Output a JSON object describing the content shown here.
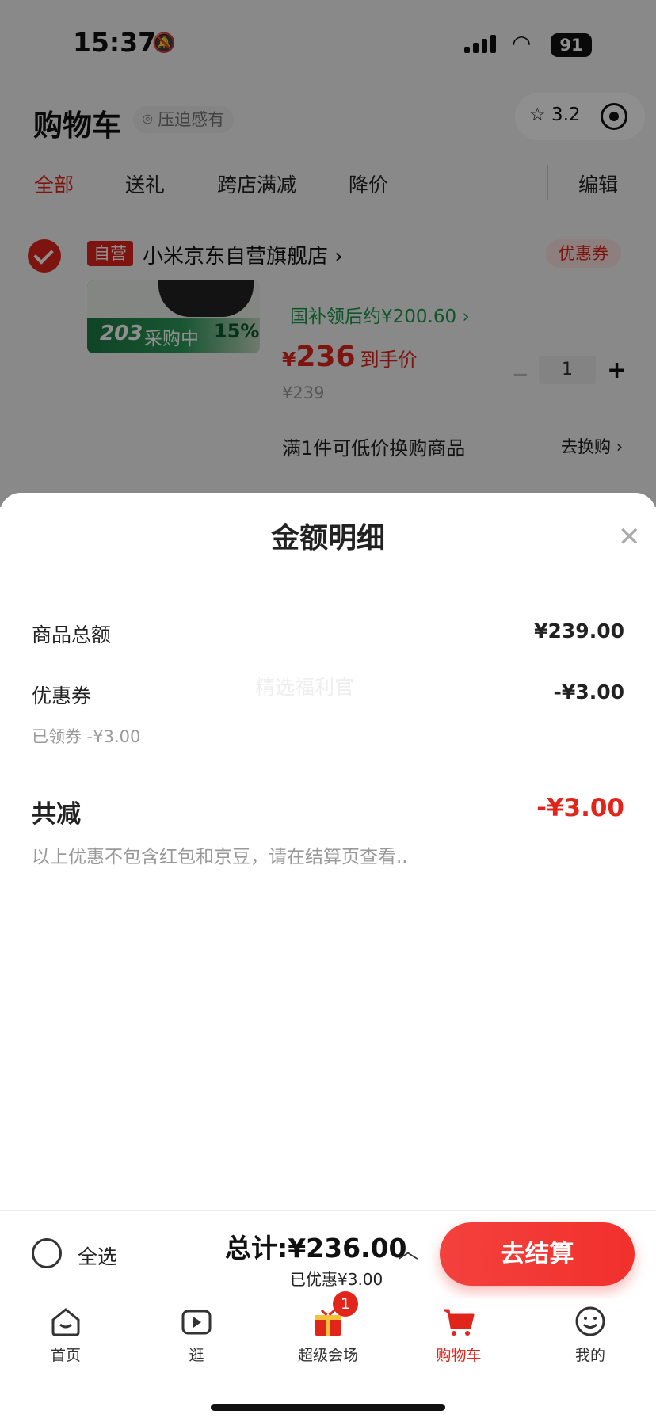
{
  "status_bar": {
    "time": "15:37",
    "battery": "91"
  },
  "header": {
    "title": "购物车",
    "location": "压迫感有",
    "capsule_score": "3.2"
  },
  "tabs": [
    "全部",
    "送礼",
    "跨店满减",
    "降价"
  ],
  "edit_label": "编辑",
  "shop": {
    "badge": "自营",
    "name": "小米京东自营旗舰店",
    "coupon": "优惠券"
  },
  "product": {
    "image_text": {
      "count": "203",
      "status": "采购中",
      "percent": "15%"
    },
    "subsidy": "国补领后约¥200.60",
    "price_symbol": "¥",
    "price": "236",
    "price_label": "到手价",
    "original_price": "¥239",
    "quantity": "1",
    "swap_text": "满1件可低价换购商品",
    "swap_action": "去换购"
  },
  "sheet": {
    "title": "金额明细",
    "rows": [
      {
        "label": "商品总额",
        "value": "¥239.00"
      },
      {
        "label": "优惠券",
        "value": "-¥3.00",
        "sub": "已领券 -¥3.00"
      }
    ],
    "watermark": "精选福利官",
    "total_label": "共减",
    "total_value": "-¥3.00",
    "note": "以上优惠不包含红包和京豆，请在结算页查看.."
  },
  "bottom_bar": {
    "select_all": "全选",
    "total": "总计:¥236.00",
    "saved": "已优惠¥3.00",
    "checkout": "去结算"
  },
  "nav": {
    "items": [
      {
        "label": "首页",
        "icon": "home-icon"
      },
      {
        "label": "逛",
        "icon": "play-icon"
      },
      {
        "label": "超级会场",
        "icon": "gift-icon",
        "badge": "1"
      },
      {
        "label": "购物车",
        "icon": "cart-icon",
        "active": true
      },
      {
        "label": "我的",
        "icon": "smile-icon"
      }
    ]
  },
  "colors": {
    "accent": "#e1251b",
    "subsidy_green": "#1a9a4a"
  }
}
